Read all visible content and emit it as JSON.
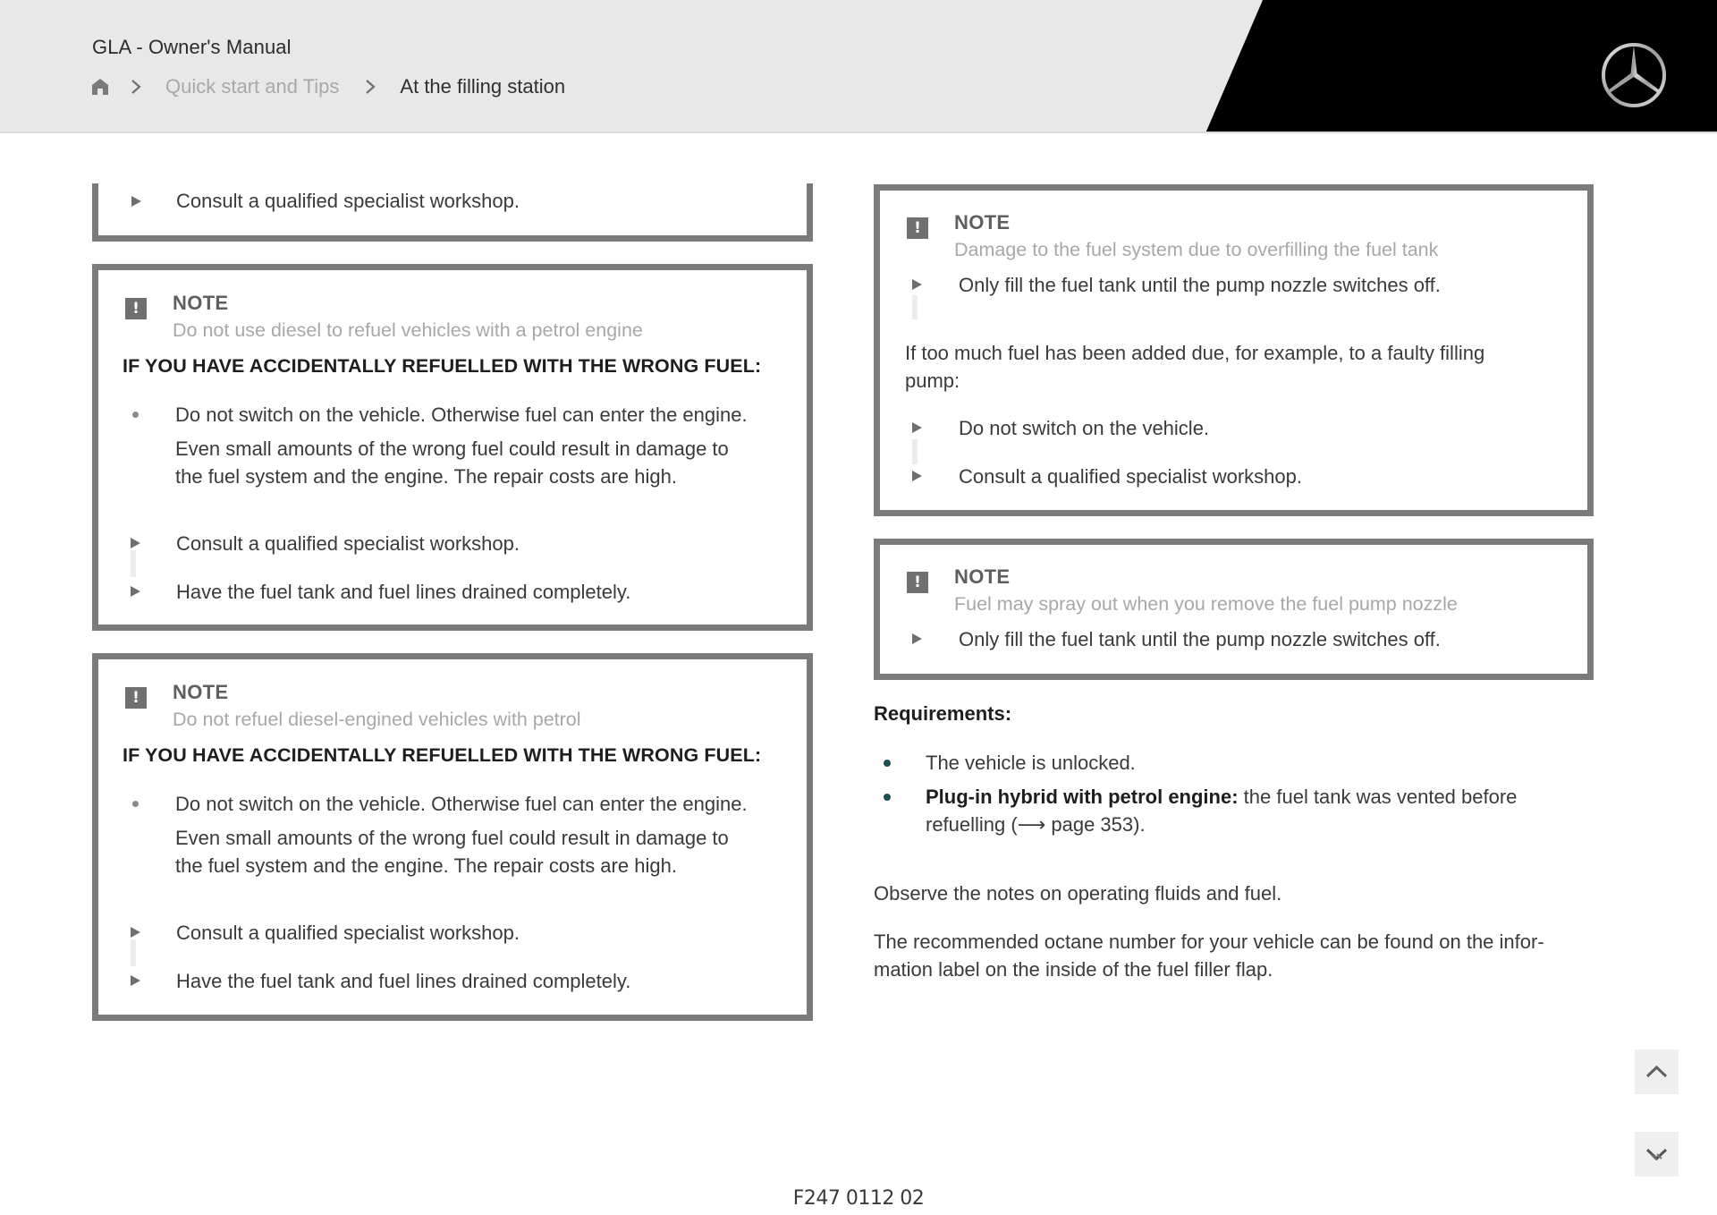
{
  "header": {
    "app_title": "GLA - Owner's Manual",
    "breadcrumb": {
      "home_icon": "home-icon",
      "separator_icon": "chevron-right-icon",
      "items": [
        {
          "label": "Quick start and Tips",
          "state": "link"
        },
        {
          "label": "At the filling station",
          "state": "current"
        }
      ]
    },
    "logo": "mercedes-benz-star-logo"
  },
  "left_column": {
    "continued_box": {
      "steps": [
        "Consult a qualified specialist workshop."
      ]
    },
    "notes": [
      {
        "label": "NOTE",
        "subtitle": "Do not use diesel to refuel vehicles with a petrol engine",
        "heading": "IF YOU HAVE ACCIDENTALLY REFUELLED WITH THE WRONG FUEL:",
        "bullet": "Do not switch on the vehicle. Otherwise fuel can enter the engine.",
        "detail_lines": [
          "Even small amounts of the wrong fuel could result in damage to",
          "the fuel system and the engine. The repair costs are high."
        ],
        "steps": [
          "Consult a qualified specialist workshop.",
          "Have the fuel tank and fuel lines drained completely."
        ]
      },
      {
        "label": "NOTE",
        "subtitle": "Do not refuel diesel-engined vehicles with petrol",
        "heading": "IF YOU HAVE ACCIDENTALLY REFUELLED WITH THE WRONG FUEL:",
        "bullet": "Do not switch on the vehicle. Otherwise fuel can enter the engine.",
        "detail_lines": [
          "Even small amounts of the wrong fuel could result in damage to",
          "the fuel system and the engine. The repair costs are high."
        ],
        "steps": [
          "Consult a qualified specialist workshop.",
          "Have the fuel tank and fuel lines drained completely."
        ]
      }
    ]
  },
  "right_column": {
    "notes": [
      {
        "label": "NOTE",
        "subtitle": "Damage to the fuel system due to overfilling the fuel tank",
        "step": "Only fill the fuel tank until the pump nozzle switches off.",
        "paragraph_lines": [
          "If too much fuel has been added due, for example, to a faulty filling",
          "pump:"
        ],
        "steps": [
          "Do not switch on the vehicle.",
          "Consult a qualified specialist workshop."
        ]
      },
      {
        "label": "NOTE",
        "subtitle": "Fuel may spray out when you remove the fuel pump nozzle",
        "step": "Only fill the fuel tank until the pump nozzle switches off."
      }
    ],
    "requirements": {
      "title": "Requirements:",
      "items": [
        {
          "text": "The vehicle is unlocked."
        },
        {
          "bold": "Plug-in hybrid with petrol engine:",
          "text": " the fuel tank was vented before",
          "continuation": "refuelling (⟶ page 353)."
        }
      ],
      "bullet_color": "#1f4f55"
    },
    "paragraphs": [
      "Observe the notes on operating fluids and fuel.",
      "The recommended octane number for your vehicle can be found on the infor-",
      "mation label on the inside of the fuel filler flap."
    ]
  },
  "side_buttons": {
    "scroll_up_icon": "chevron-up-icon",
    "scroll_down_icon": "chevron-down-icon"
  },
  "footer": {
    "code": "F247 0112 02"
  },
  "colors": {
    "header_bg": "#e8e8e8",
    "header_accent": "#000000",
    "box_border": "#7b7b7b",
    "note_icon": "#707070",
    "teal_bullet": "#1f4f55"
  }
}
